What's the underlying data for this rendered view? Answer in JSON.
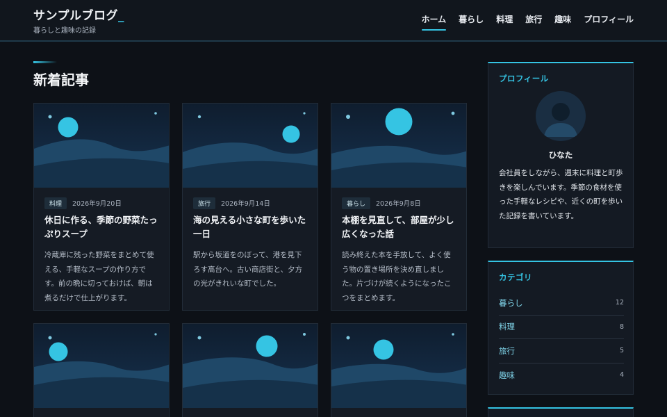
{
  "header": {
    "title": "サンプルブログ",
    "title_cursor": "_",
    "tagline": "暮らしと趣味の記録",
    "nav": [
      {
        "label": "ホーム",
        "active": true
      },
      {
        "label": "暮らし",
        "active": false
      },
      {
        "label": "料理",
        "active": false
      },
      {
        "label": "旅行",
        "active": false
      },
      {
        "label": "趣味",
        "active": false
      },
      {
        "label": "プロフィール",
        "active": false
      }
    ]
  },
  "main": {
    "section_title": "新着記事",
    "posts": [
      {
        "category": "料理",
        "date": "2026年9月20日",
        "title": "休日に作る、季節の野菜たっぷりスープ",
        "excerpt": "冷蔵庫に残った野菜をまとめて使える、手軽なスープの作り方です。前の晩に切っておけば、朝は煮るだけで仕上がります。"
      },
      {
        "category": "旅行",
        "date": "2026年9月14日",
        "title": "海の見える小さな町を歩いた一日",
        "excerpt": "駅から坂道をのぼって、港を見下ろす高台へ。古い商店街と、夕方の光がきれいな町でした。"
      },
      {
        "category": "暮らし",
        "date": "2026年9月8日",
        "title": "本棚を見直して、部屋が少し広くなった話",
        "excerpt": "読み終えた本を手放して、よく使う物の置き場所を決め直しました。片づけが続くようになったこつをまとめます。"
      },
      {
        "category": "",
        "date": "",
        "title": "",
        "excerpt": ""
      },
      {
        "category": "",
        "date": "",
        "title": "",
        "excerpt": ""
      },
      {
        "category": "",
        "date": "",
        "title": "",
        "excerpt": ""
      }
    ]
  },
  "sidebar": {
    "profile": {
      "heading": "プロフィール",
      "name": "ひなた",
      "bio": "会社員をしながら、週末に料理と町歩きを楽しんでいます。季節の食材を使った手軽なレシピや、近くの町を歩いた記録を書いています。"
    },
    "categories": {
      "heading": "カテゴリ",
      "items": [
        {
          "name": "暮らし",
          "count": "12"
        },
        {
          "name": "料理",
          "count": "8"
        },
        {
          "name": "旅行",
          "count": "5"
        },
        {
          "name": "趣味",
          "count": "4"
        }
      ]
    }
  },
  "colors": {
    "accent": "#35c4e3",
    "background": "#0d1117",
    "card": "#151b24"
  },
  "icons": {
    "avatar": "user-avatar-icon",
    "thumbnail": "night-landscape-illustration"
  }
}
